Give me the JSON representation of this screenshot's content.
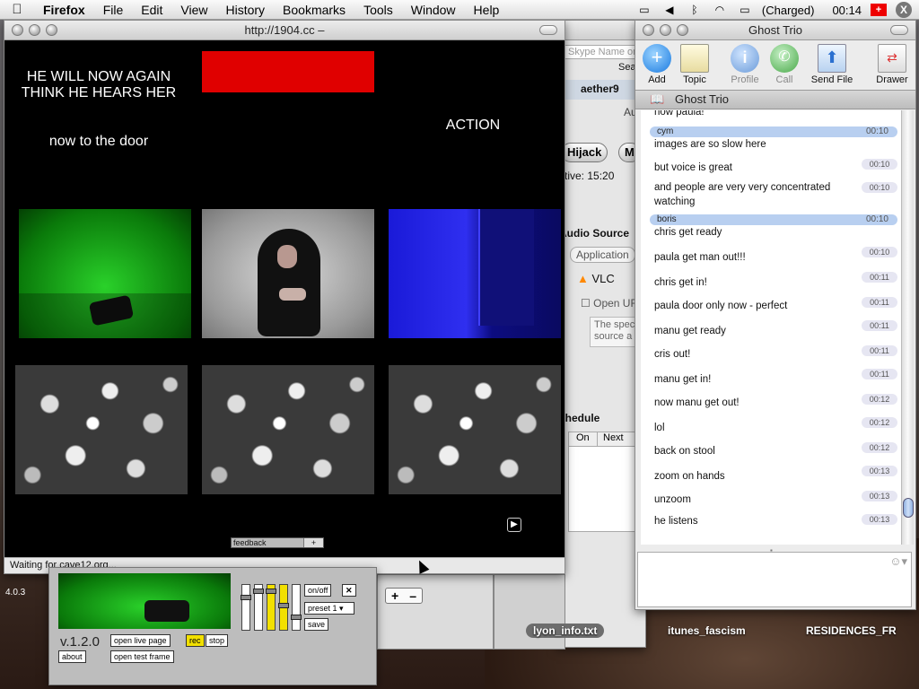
{
  "menubar": {
    "app": "Firefox",
    "items": [
      "File",
      "Edit",
      "View",
      "History",
      "Bookmarks",
      "Tools",
      "Window",
      "Help"
    ],
    "battery": "(Charged)",
    "clock": "00:14"
  },
  "firefox": {
    "title": "http://1904.cc –",
    "overlay": {
      "line1": "HE WILL NOW AGAIN",
      "line2": "THINK HE HEARS HER",
      "door": "now to the door",
      "action": "ACTION"
    },
    "feedback_label": "feedback",
    "feedback_plus": "+",
    "status": "Waiting for cave12.org..."
  },
  "skype": {
    "search_placeholder": "Skype Name or",
    "search_btn": "Sea",
    "user": "aether9",
    "au": "Au",
    "hijack": "Hijack",
    "m": "M",
    "active": "ctive: 15:20",
    "audio_source": "Audio Source",
    "application": "Application",
    "vlc": "VLC",
    "open_url": "Open UR",
    "spec1": "The spec",
    "spec2": "source a",
    "schedule": "chedule",
    "col_on": "On",
    "col_next": "Next",
    "plus": "+",
    "minus": "–"
  },
  "vj": {
    "version": "v.1.2.0",
    "btn_live": "open live page",
    "btn_test": "open test frame",
    "btn_about": "about",
    "btn_rec": "rec",
    "btn_stop": "stop",
    "btn_onoff": "on/off",
    "preset": "preset 1",
    "btn_save": "save",
    "sliders": [
      0.75,
      0.9,
      0.9,
      0.55,
      0.25
    ]
  },
  "ghost": {
    "title": "Ghost Trio",
    "toolbar": [
      "Add",
      "Topic",
      "Profile",
      "Call",
      "Send File",
      "Drawer"
    ],
    "room": "Ghost Trio",
    "messages": [
      {
        "type": "text",
        "text": "now paula!"
      },
      {
        "type": "sender",
        "name": "cym",
        "time": "00:10"
      },
      {
        "type": "text",
        "text": "images are so slow here",
        "time": "00:10"
      },
      {
        "type": "text",
        "text": "but voice is great",
        "time": "00:10"
      },
      {
        "type": "text",
        "text": "and people are very very concentrated watching"
      },
      {
        "type": "sender",
        "name": "boris",
        "time": "00:10"
      },
      {
        "type": "text",
        "text": "chris get ready",
        "time": "00:10"
      },
      {
        "type": "text",
        "text": "paula get man out!!!",
        "time": "00:11"
      },
      {
        "type": "text",
        "text": "chris get in!",
        "time": "00:11"
      },
      {
        "type": "text",
        "text": "paula door only now - perfect",
        "time": "00:11"
      },
      {
        "type": "text",
        "text": "manu get ready",
        "time": "00:11"
      },
      {
        "type": "text",
        "text": "cris out!",
        "time": "00:11"
      },
      {
        "type": "text",
        "text": "manu get in!",
        "time": "00:12"
      },
      {
        "type": "text",
        "text": "now manu get out!",
        "time": "00:12"
      },
      {
        "type": "text",
        "text": "lol",
        "time": "00:12"
      },
      {
        "type": "text",
        "text": "back on stool",
        "time": "00:13"
      },
      {
        "type": "text",
        "text": "zoom on hands",
        "time": "00:13"
      },
      {
        "type": "text",
        "text": "unzoom",
        "time": "00:13"
      },
      {
        "type": "text",
        "text": "he listens"
      }
    ]
  },
  "desktop": {
    "version_label": "4.0.3",
    "icons": [
      "lyon_info.txt",
      "itunes_fascism",
      "RESIDENCES_FR"
    ]
  }
}
